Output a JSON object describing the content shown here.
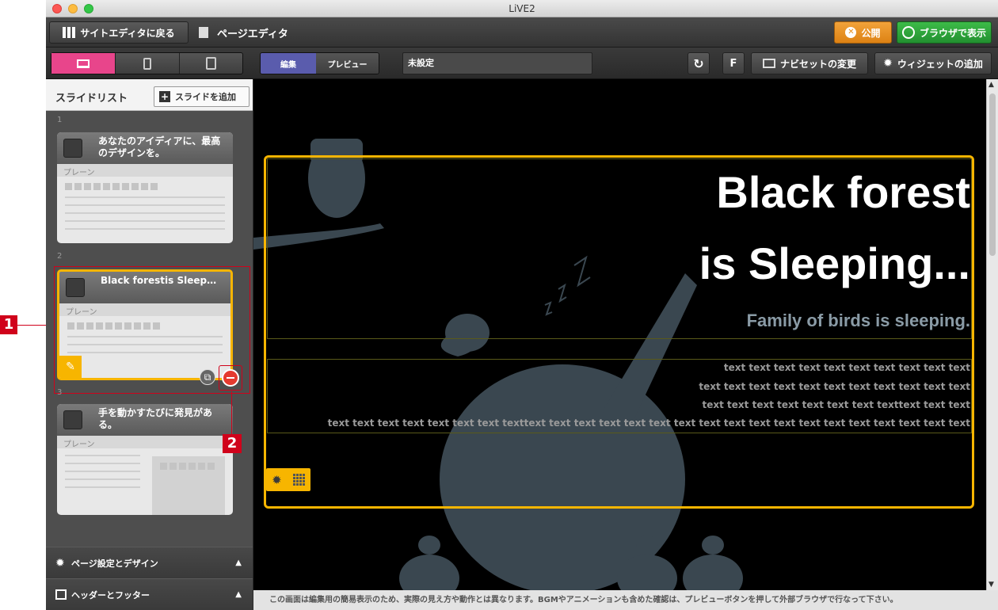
{
  "window": {
    "title": "LiVE2"
  },
  "toolbar": {
    "back_label": "サイトエディタに戻る",
    "page_editor_label": "ページエディタ",
    "publish_label": "公開",
    "browser_label": "ブラウザで表示"
  },
  "modebar": {
    "edit_label": "編集",
    "preview_label": "プレビュー",
    "status_value": "未設定",
    "f_label": "F",
    "navset_label": "ナビセットの変更",
    "widget_label": "ウィジェットの追加"
  },
  "sidebar": {
    "title": "スライドリスト",
    "add_label": "スライドを追加",
    "slides": [
      {
        "num": "1",
        "title": "あなたのアイディアに、最高のデザインを。",
        "type": "プレーン"
      },
      {
        "num": "2",
        "title": "Black forestis Sleep…",
        "type": "プレーン"
      },
      {
        "num": "3",
        "title": "手を動かすたびに発見がある。",
        "type": "プレーン"
      }
    ],
    "page_settings_label": "ページ設定とデザイン",
    "header_footer_label": "ヘッダーとフッター"
  },
  "canvas": {
    "heading_line1": "Black forest",
    "heading_line2": "is Sleeping...",
    "subheading": "Family of birds is sleeping.",
    "text_lines": [
      "text text text text text text text text text text",
      "text text text text text text text text text text text",
      "text text text text text text text texttext text text",
      "text text text text text text text texttext text text text text text text text text text text text text text text text text text"
    ]
  },
  "footer": {
    "note": "この画面は編集用の簡易表示のため、実際の見え方や動作とは異なります。BGMやアニメーションも含めた確認は、プレビューボタンを押して外部ブラウザで行なって下さい。"
  },
  "callouts": {
    "one": "1",
    "two": "2"
  },
  "colors": {
    "accent_pink": "#e8458b",
    "publish_orange": "#e8901a",
    "browser_green": "#2fa43a",
    "selection_yellow": "#f7b500",
    "callout_red": "#d0021b"
  }
}
